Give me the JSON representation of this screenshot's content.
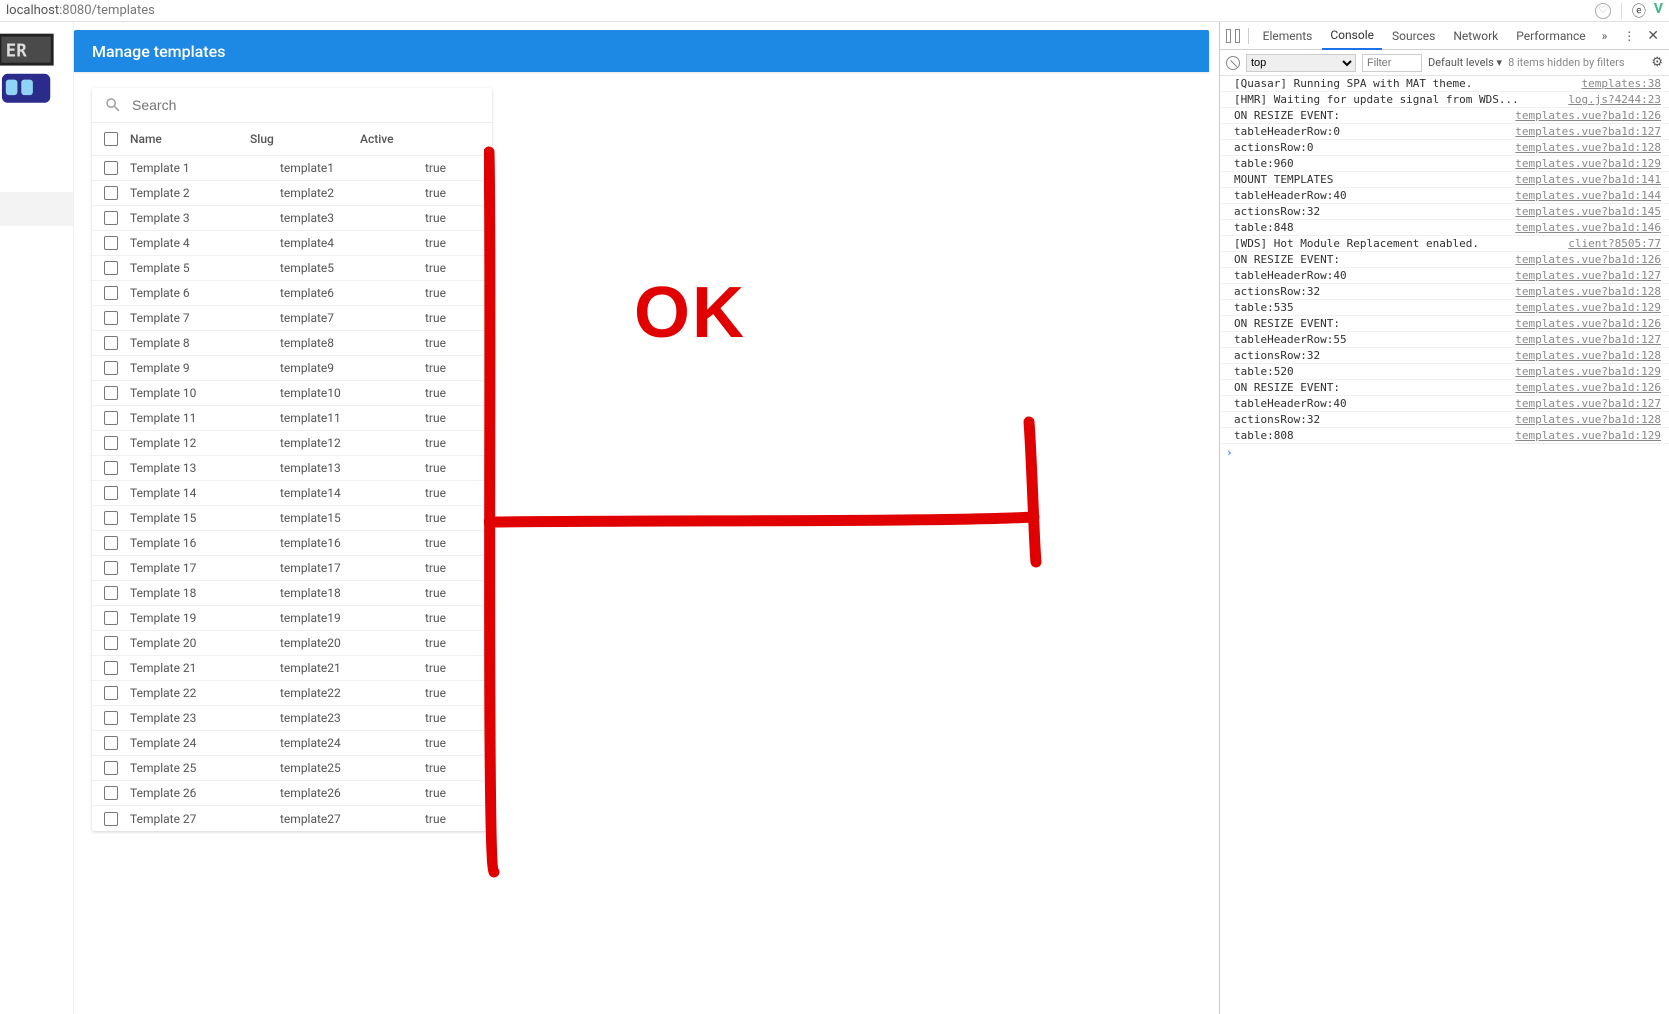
{
  "url": {
    "host": "localhost",
    "port": ":8080",
    "path": "/templates"
  },
  "header": {
    "title": "Manage templates"
  },
  "search": {
    "placeholder": "Search"
  },
  "table": {
    "columns": {
      "name": "Name",
      "slug": "Slug",
      "active": "Active"
    },
    "rows": [
      {
        "name": "Template 1",
        "slug": "template1",
        "active": "true"
      },
      {
        "name": "Template 2",
        "slug": "template2",
        "active": "true"
      },
      {
        "name": "Template 3",
        "slug": "template3",
        "active": "true"
      },
      {
        "name": "Template 4",
        "slug": "template4",
        "active": "true"
      },
      {
        "name": "Template 5",
        "slug": "template5",
        "active": "true"
      },
      {
        "name": "Template 6",
        "slug": "template6",
        "active": "true"
      },
      {
        "name": "Template 7",
        "slug": "template7",
        "active": "true"
      },
      {
        "name": "Template 8",
        "slug": "template8",
        "active": "true"
      },
      {
        "name": "Template 9",
        "slug": "template9",
        "active": "true"
      },
      {
        "name": "Template 10",
        "slug": "template10",
        "active": "true"
      },
      {
        "name": "Template 11",
        "slug": "template11",
        "active": "true"
      },
      {
        "name": "Template 12",
        "slug": "template12",
        "active": "true"
      },
      {
        "name": "Template 13",
        "slug": "template13",
        "active": "true"
      },
      {
        "name": "Template 14",
        "slug": "template14",
        "active": "true"
      },
      {
        "name": "Template 15",
        "slug": "template15",
        "active": "true"
      },
      {
        "name": "Template 16",
        "slug": "template16",
        "active": "true"
      },
      {
        "name": "Template 17",
        "slug": "template17",
        "active": "true"
      },
      {
        "name": "Template 18",
        "slug": "template18",
        "active": "true"
      },
      {
        "name": "Template 19",
        "slug": "template19",
        "active": "true"
      },
      {
        "name": "Template 20",
        "slug": "template20",
        "active": "true"
      },
      {
        "name": "Template 21",
        "slug": "template21",
        "active": "true"
      },
      {
        "name": "Template 22",
        "slug": "template22",
        "active": "true"
      },
      {
        "name": "Template 23",
        "slug": "template23",
        "active": "true"
      },
      {
        "name": "Template 24",
        "slug": "template24",
        "active": "true"
      },
      {
        "name": "Template 25",
        "slug": "template25",
        "active": "true"
      },
      {
        "name": "Template 26",
        "slug": "template26",
        "active": "true"
      },
      {
        "name": "Template 27",
        "slug": "template27",
        "active": "true"
      }
    ]
  },
  "annotation": {
    "ok": "OK"
  },
  "devtools": {
    "tabs": [
      "Elements",
      "Console",
      "Sources",
      "Network",
      "Performance"
    ],
    "active_tab": "Console",
    "more": "»",
    "toolbar": {
      "context": "top",
      "filter_placeholder": "Filter",
      "levels": "Default levels ▾",
      "hidden": "8 items hidden by filters"
    },
    "logs": [
      {
        "msg": "[Quasar] Running SPA with MAT theme.",
        "src": "templates:38"
      },
      {
        "msg": "[HMR] Waiting for update signal from WDS...",
        "src": "log.js?4244:23"
      },
      {
        "msg": "ON RESIZE EVENT:",
        "src": "templates.vue?ba1d:126"
      },
      {
        "msg": "tableHeaderRow:0",
        "src": "templates.vue?ba1d:127"
      },
      {
        "msg": "actionsRow:0",
        "src": "templates.vue?ba1d:128"
      },
      {
        "msg": "table:960",
        "src": "templates.vue?ba1d:129"
      },
      {
        "msg": "MOUNT TEMPLATES",
        "src": "templates.vue?ba1d:141"
      },
      {
        "msg": "tableHeaderRow:40",
        "src": "templates.vue?ba1d:144"
      },
      {
        "msg": "actionsRow:32",
        "src": "templates.vue?ba1d:145"
      },
      {
        "msg": "table:848",
        "src": "templates.vue?ba1d:146"
      },
      {
        "msg": "[WDS] Hot Module Replacement enabled.",
        "src": "client?8505:77"
      },
      {
        "msg": "ON RESIZE EVENT:",
        "src": "templates.vue?ba1d:126"
      },
      {
        "msg": "tableHeaderRow:40",
        "src": "templates.vue?ba1d:127"
      },
      {
        "msg": "actionsRow:32",
        "src": "templates.vue?ba1d:128"
      },
      {
        "msg": "table:535",
        "src": "templates.vue?ba1d:129"
      },
      {
        "msg": "ON RESIZE EVENT:",
        "src": "templates.vue?ba1d:126"
      },
      {
        "msg": "tableHeaderRow:55",
        "src": "templates.vue?ba1d:127"
      },
      {
        "msg": "actionsRow:32",
        "src": "templates.vue?ba1d:128"
      },
      {
        "msg": "table:520",
        "src": "templates.vue?ba1d:129"
      },
      {
        "msg": "ON RESIZE EVENT:",
        "src": "templates.vue?ba1d:126"
      },
      {
        "msg": "tableHeaderRow:40",
        "src": "templates.vue?ba1d:127"
      },
      {
        "msg": "actionsRow:32",
        "src": "templates.vue?ba1d:128"
      },
      {
        "msg": "table:808",
        "src": "templates.vue?ba1d:129"
      }
    ]
  }
}
